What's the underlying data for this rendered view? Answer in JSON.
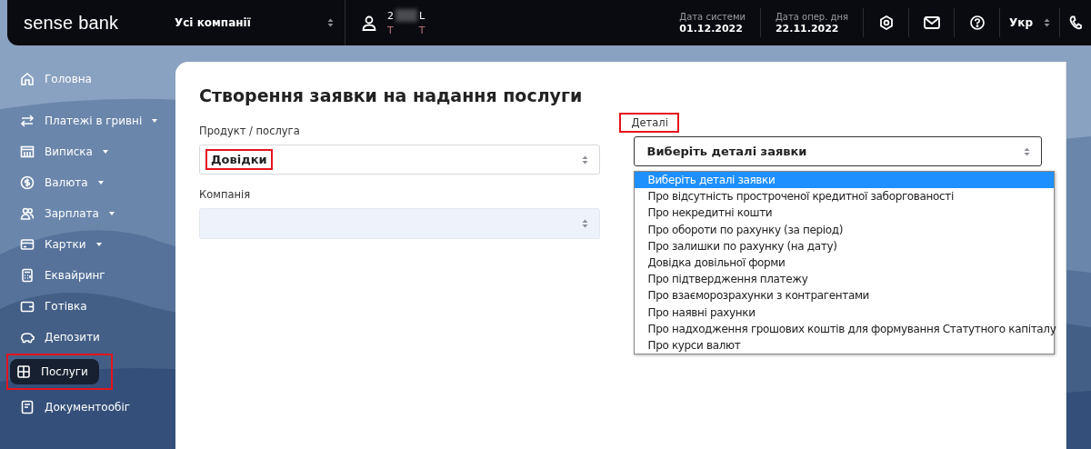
{
  "header": {
    "logo": "sense bank",
    "company_select": {
      "value": "Усі компанії"
    },
    "user": {
      "name_parts": [
        "2",
        "L"
      ],
      "sub_parts": [
        "T",
        "T"
      ]
    },
    "dates": [
      {
        "label": "Дата системи",
        "value": "01.12.2022"
      },
      {
        "label": "Дата опер. дня",
        "value": "22.11.2022"
      }
    ],
    "language": "Укр"
  },
  "sidebar": {
    "items": [
      {
        "kind": "home",
        "label": "Головна",
        "has_submenu": false,
        "selected": false,
        "highlighted": false
      },
      {
        "kind": "transfer",
        "label": "Платежі в гривні",
        "has_submenu": true,
        "selected": false,
        "highlighted": false
      },
      {
        "kind": "statement",
        "label": "Виписка",
        "has_submenu": true,
        "selected": false,
        "highlighted": false
      },
      {
        "kind": "currency",
        "label": "Валюта",
        "has_submenu": true,
        "selected": false,
        "highlighted": false
      },
      {
        "kind": "people",
        "label": "Зарплата",
        "has_submenu": true,
        "selected": false,
        "highlighted": false
      },
      {
        "kind": "card",
        "label": "Картки",
        "has_submenu": true,
        "selected": false,
        "highlighted": false
      },
      {
        "kind": "calculator",
        "label": "Еквайринг",
        "has_submenu": false,
        "selected": false,
        "highlighted": false
      },
      {
        "kind": "wallet",
        "label": "Готівка",
        "has_submenu": false,
        "selected": false,
        "highlighted": false
      },
      {
        "kind": "piggy",
        "label": "Депозити",
        "has_submenu": false,
        "selected": false,
        "highlighted": false
      },
      {
        "kind": "grid",
        "label": "Послуги",
        "has_submenu": false,
        "selected": true,
        "highlighted": true
      },
      {
        "kind": "document",
        "label": "Документообіг",
        "has_submenu": false,
        "selected": false,
        "highlighted": false
      }
    ]
  },
  "form": {
    "title": "Створення заявки на надання послуги",
    "product": {
      "label": "Продукт / послуга",
      "value": "Довідки",
      "value_highlighted": true
    },
    "company": {
      "label": "Компанія",
      "disabled": true
    },
    "details": {
      "label": "Деталі",
      "label_highlighted": true,
      "value": "Виберіть деталі заявки",
      "expanded": true,
      "options": [
        {
          "label": "Виберіть деталі заявки",
          "selected": true
        },
        {
          "label": "Про відсутність простроченої кредитної заборгованості",
          "selected": false
        },
        {
          "label": "Про некредитні кошти",
          "selected": false
        },
        {
          "label": "Про обороти по рахунку (за період)",
          "selected": false
        },
        {
          "label": "Про залишки по рахунку (на дату)",
          "selected": false
        },
        {
          "label": "Довідка довільної форми",
          "selected": false
        },
        {
          "label": "Про підтвердження платежу",
          "selected": false
        },
        {
          "label": "Про взаєморозрахунки з контрагентами",
          "selected": false
        },
        {
          "label": "Про наявні рахунки",
          "selected": false
        },
        {
          "label": "Про надходження грошових коштів для формування Статутного капіталу",
          "selected": false
        },
        {
          "label": "Про курси валют",
          "selected": false
        }
      ]
    }
  }
}
